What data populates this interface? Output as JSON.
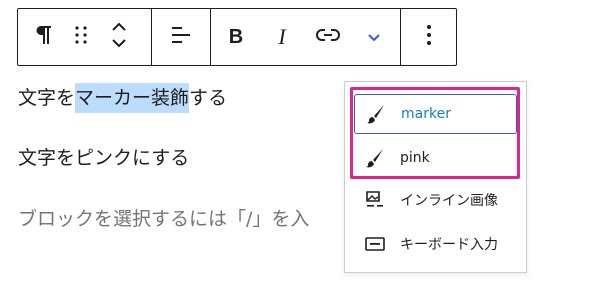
{
  "toolbar": {
    "paragraph_icon": "pilcrow-icon",
    "drag_icon": "drag-handle-icon",
    "move_icon": "move-up-down-icon",
    "align_icon": "align-left-icon",
    "bold_label": "B",
    "italic_label": "I",
    "link_icon": "link-icon",
    "more_icon": "chevron-down-icon",
    "options_icon": "kebab-icon",
    "accent_color": "#3858e9"
  },
  "content": {
    "p1_before": "文字を",
    "p1_highlight": "マーカー装飾",
    "p1_after": "する",
    "p2": "文字をピンクにする",
    "p3_placeholder": "ブロックを選択するには「/」を入"
  },
  "dropdown": {
    "items": [
      {
        "label": "marker",
        "icon": "brush-icon"
      },
      {
        "label": "pink",
        "icon": "brush-icon"
      },
      {
        "label": "インライン画像",
        "icon": "inline-image-icon"
      },
      {
        "label": "キーボード入力",
        "icon": "keyboard-input-icon"
      }
    ],
    "highlight_color": "#e0258a",
    "selected_color": "#1e78c8"
  }
}
